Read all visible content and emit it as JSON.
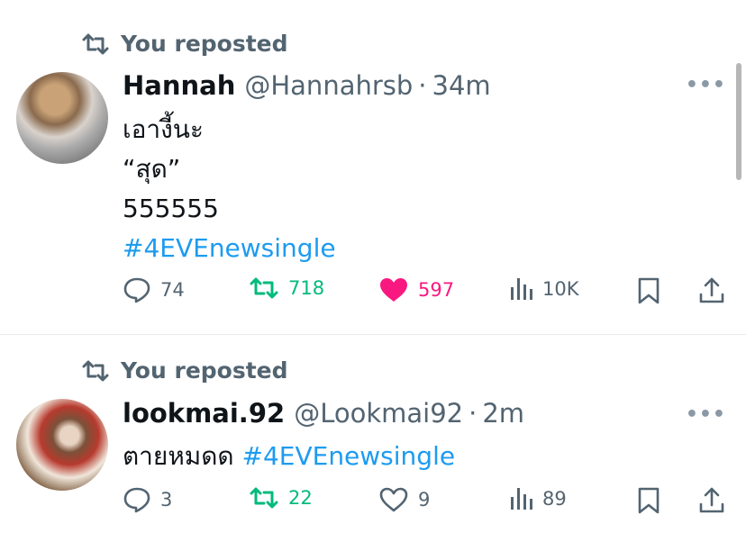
{
  "colors": {
    "text_primary": "#0f1419",
    "text_secondary": "#536471",
    "link": "#1d9bf0",
    "repost_active": "#00ba7c",
    "like_active": "#f91880"
  },
  "tweets": [
    {
      "repost_label": "You reposted",
      "name": "Hannah",
      "handle": "@Hannahrsb",
      "separator": "·",
      "time": "34m",
      "more": "•••",
      "lines": [
        "เอางี้นะ",
        "“สุด”",
        "555555"
      ],
      "hashtag": "#4EVEnewsingle",
      "stats": {
        "replies": "74",
        "reposts": "718",
        "likes": "597",
        "views": "10K"
      },
      "reposted": true,
      "liked": true
    },
    {
      "repost_label": "You reposted",
      "name": "lookmai.92",
      "handle": "@Lookmai92",
      "separator": "·",
      "time": "2m",
      "more": "•••",
      "text": "ตายหมดด",
      "hashtag": "#4EVEnewsingle",
      "stats": {
        "replies": "3",
        "reposts": "22",
        "likes": "9",
        "views": "89"
      },
      "reposted": true,
      "liked": false
    }
  ]
}
